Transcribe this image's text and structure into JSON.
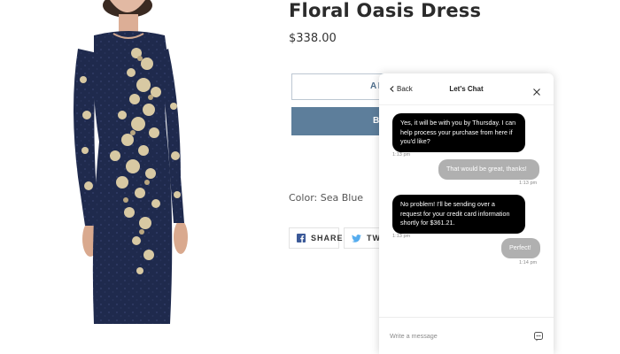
{
  "product": {
    "title": "Floral Oasis Dress",
    "price": "$338.00",
    "add_to_cart_label": "AD",
    "buy_now_label": "B",
    "color_label": "Color: Sea Blue",
    "image_icon": "dress-photo"
  },
  "share": {
    "facebook_label": "SHARE",
    "twitter_label": "TWE",
    "facebook_icon": "facebook-icon",
    "twitter_icon": "twitter-icon"
  },
  "chat": {
    "back_label": "Back",
    "title": "Let's Chat",
    "close_icon": "close-icon",
    "messages": [
      {
        "from": "agent",
        "text": "Yes, it will be with you by Thursday. I can help process your purchase from here if you'd like?",
        "time": "1:13 pm"
      },
      {
        "from": "user",
        "text": "That would be great, thanks!",
        "time": "1:13 pm"
      },
      {
        "from": "agent",
        "text": "No problem! I'll be sending over a request for your credit card information shortly for $361.21.",
        "time": "1:13 pm"
      },
      {
        "from": "user",
        "text": "Perfect!",
        "time": "1:14 pm"
      }
    ],
    "input_placeholder": "Write a message",
    "send_icon": "send-icon"
  },
  "colors": {
    "agent_bubble": "#000000",
    "user_bubble": "#b0b0b0",
    "buy_button": "#5d7e9b",
    "outline_button_text": "#4e6e8c"
  }
}
